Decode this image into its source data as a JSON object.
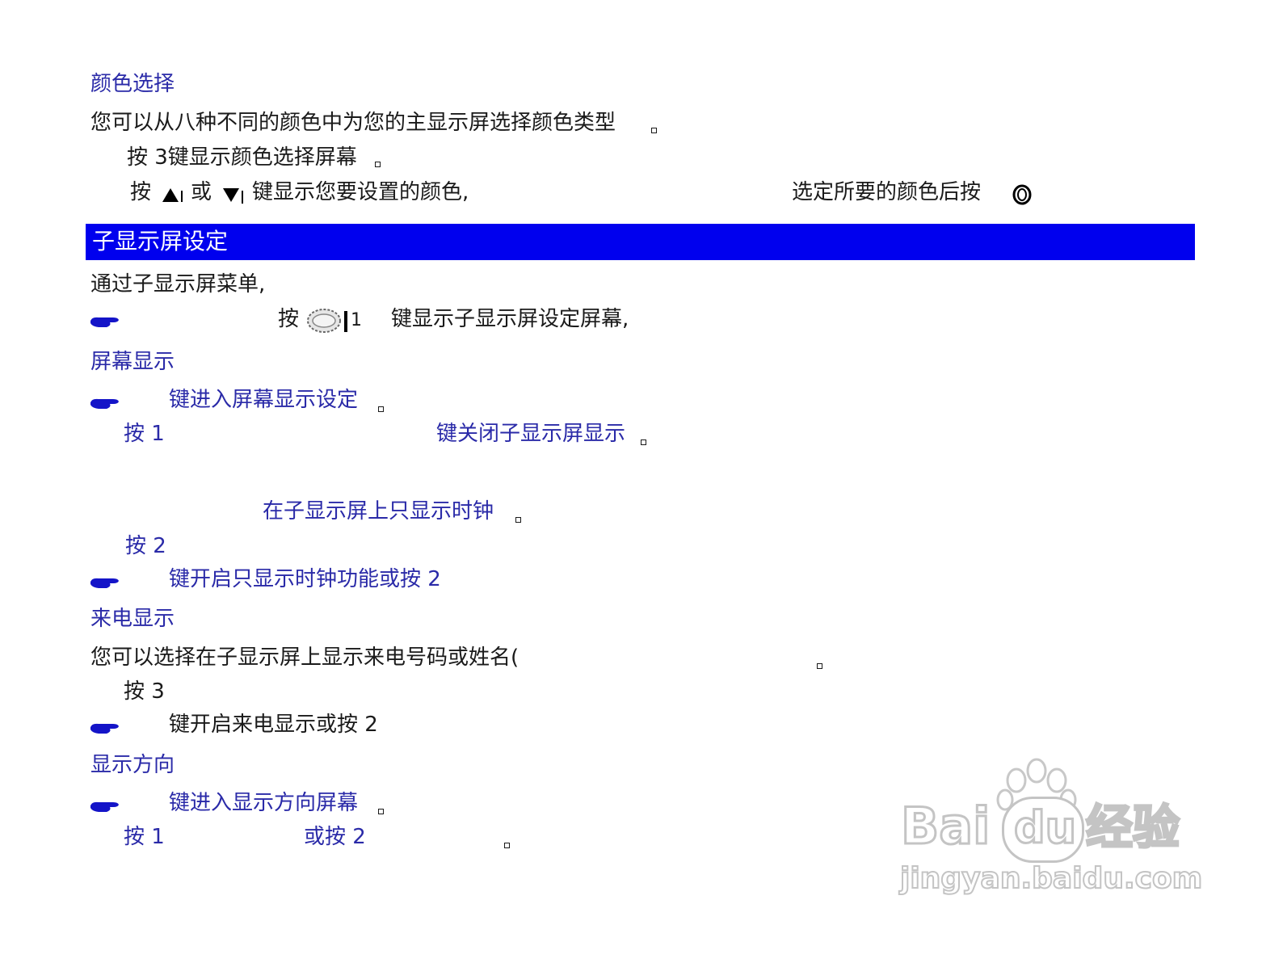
{
  "color_select": {
    "heading": "颜色选择",
    "desc": "您可以从八种不同的颜色中为您的主显示屏选择颜色类型",
    "step1": "按 3键显示颜色选择屏幕",
    "step2_a": "按",
    "step2_b": "或",
    "step2_c": "键显示您要设置的颜色,",
    "step2_d": "选定所要的颜色后按"
  },
  "sub_display": {
    "banner": "子显示屏设定",
    "intro": "通过子显示屏菜单,",
    "menu_press": "按",
    "menu_key_num": "1",
    "menu_result": "键显示子显示屏设定屏幕,"
  },
  "screen_display": {
    "heading": "屏幕显示",
    "enter": "键进入屏幕显示设定",
    "press1": "按 1",
    "close": "键关闭子显示屏显示",
    "clock_only": "在子显示屏上只显示时钟",
    "press2": "按 2",
    "enable_clock": "键开启只显示时钟功能或按 2"
  },
  "caller_display": {
    "heading": "来电显示",
    "desc": "您可以选择在子显示屏上显示来电号码或姓名(",
    "press3": "按 3",
    "enable": "键开启来电显示或按 2"
  },
  "direction": {
    "heading": "显示方向",
    "enter": "键进入显示方向屏幕",
    "press1": "按 1",
    "or_press2": "或按 2"
  },
  "watermark": {
    "brand_latin": "Bai",
    "brand_du": "du",
    "brand_cn": "经验",
    "url": "jingyan.baidu.com"
  },
  "colors": {
    "heading_blue": "#2a2aa8",
    "banner_blue": "#0000ee",
    "text": "#1a1a1a"
  },
  "icons": {
    "hand": "pointing-hand-icon",
    "up": "triangle-up-key-icon",
    "down": "triangle-down-key-icon",
    "menu": "menu-key-icon",
    "ok": "ok-key-icon"
  }
}
